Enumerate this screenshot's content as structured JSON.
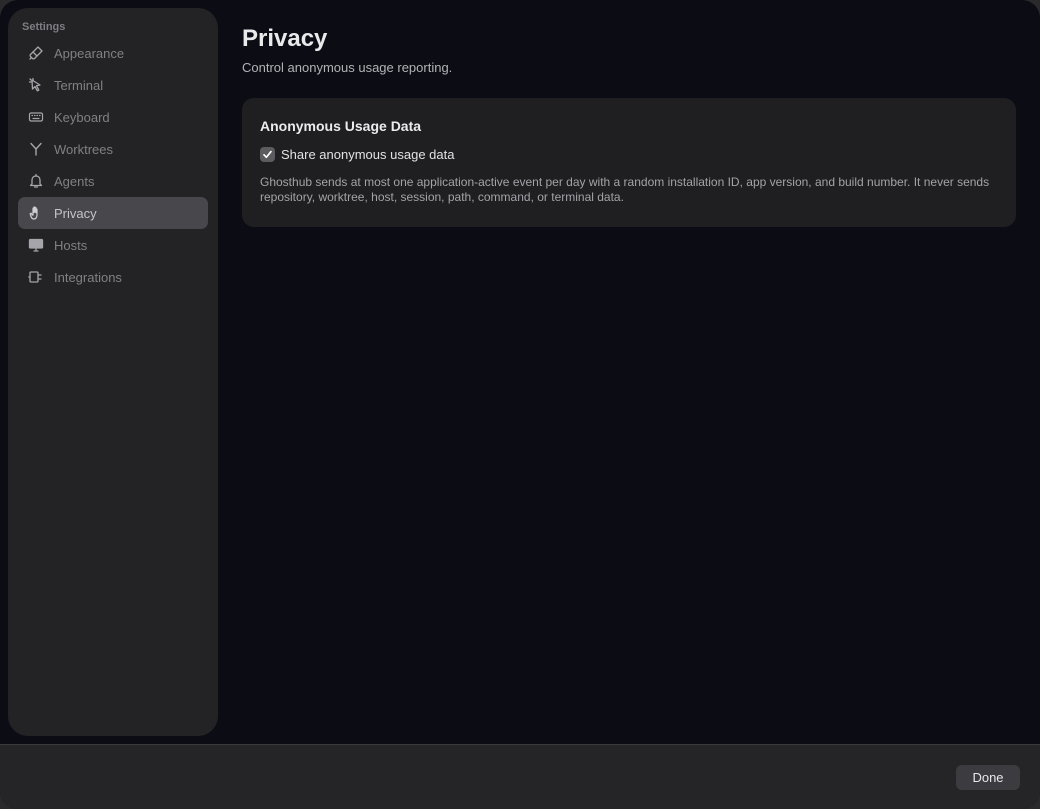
{
  "sidebar": {
    "heading": "Settings",
    "items": [
      {
        "label": "Appearance",
        "icon": "paintbrush-icon",
        "selected": false
      },
      {
        "label": "Terminal",
        "icon": "cursor-pointer-icon",
        "selected": false
      },
      {
        "label": "Keyboard",
        "icon": "keyboard-icon",
        "selected": false
      },
      {
        "label": "Worktrees",
        "icon": "branch-icon",
        "selected": false
      },
      {
        "label": "Agents",
        "icon": "bell-icon",
        "selected": false
      },
      {
        "label": "Privacy",
        "icon": "hand-icon",
        "selected": true
      },
      {
        "label": "Hosts",
        "icon": "display-icon",
        "selected": false
      },
      {
        "label": "Integrations",
        "icon": "plug-icon",
        "selected": false
      }
    ]
  },
  "main": {
    "title": "Privacy",
    "subtitle": "Control anonymous usage reporting.",
    "card": {
      "title": "Anonymous Usage Data",
      "checkbox": {
        "label": "Share anonymous usage data",
        "checked": true
      },
      "description": "Ghosthub sends at most one application-active event per day with a random installation ID, app version, and build number. It never sends repository, worktree, host, session, path, command, or terminal data."
    }
  },
  "footer": {
    "done_label": "Done"
  },
  "colors": {
    "window_bg": "#0c0c14",
    "sidebar_bg": "#232326",
    "selected_item_bg": "#48484c",
    "card_bg": "#1f1f22"
  }
}
